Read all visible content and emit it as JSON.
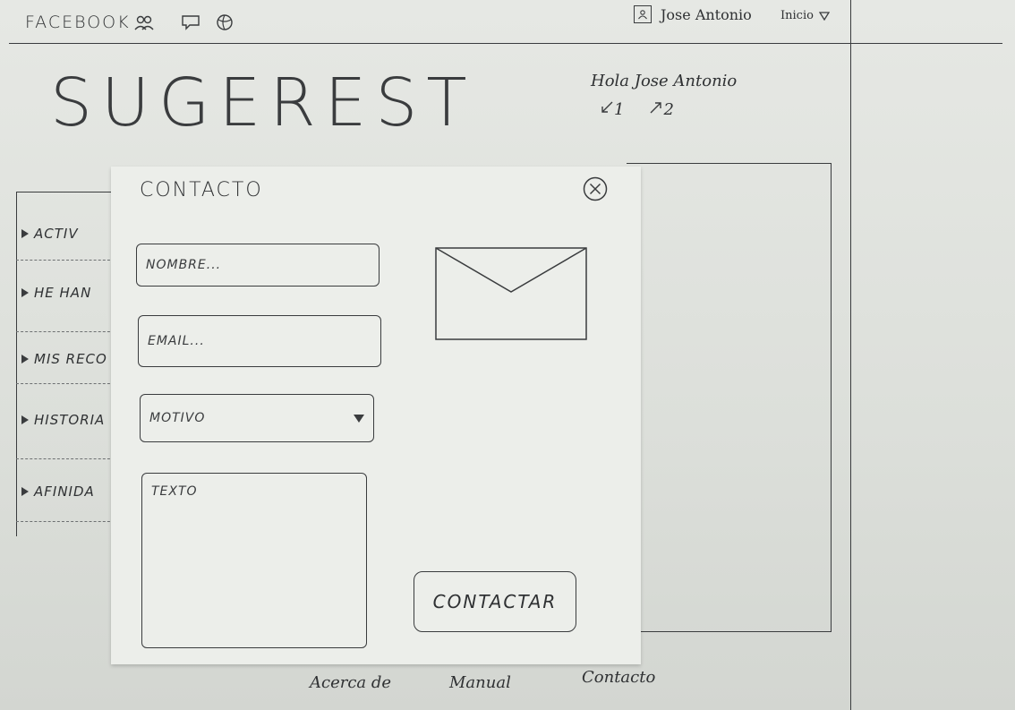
{
  "topbar": {
    "brand": "FACEBOOK",
    "user_name": "Jose Antonio",
    "menu_label": "Inicio"
  },
  "header": {
    "logo": "SUGEREST",
    "greeting": "Hola Jose Antonio",
    "counter_down": "1",
    "counter_up": "2"
  },
  "sidebar": {
    "items": [
      {
        "label": "ACTIV"
      },
      {
        "label": "HE HAN"
      },
      {
        "label": "MIS RECO"
      },
      {
        "label": "HISTORIA"
      },
      {
        "label": "AFINIDA"
      }
    ]
  },
  "modal": {
    "title": "CONTACTO",
    "name_placeholder": "NOMBRE...",
    "email_placeholder": "EMAIL...",
    "motivo_label": "MOTIVO",
    "texto_placeholder": "TEXTO",
    "submit_label": "CONTACTAR"
  },
  "footer": {
    "links": [
      {
        "label": "Acerca de"
      },
      {
        "label": "Manual"
      },
      {
        "label": "Contacto"
      }
    ]
  },
  "colors": {
    "paper": "#e6e8e4",
    "ink": "#2f3133"
  }
}
